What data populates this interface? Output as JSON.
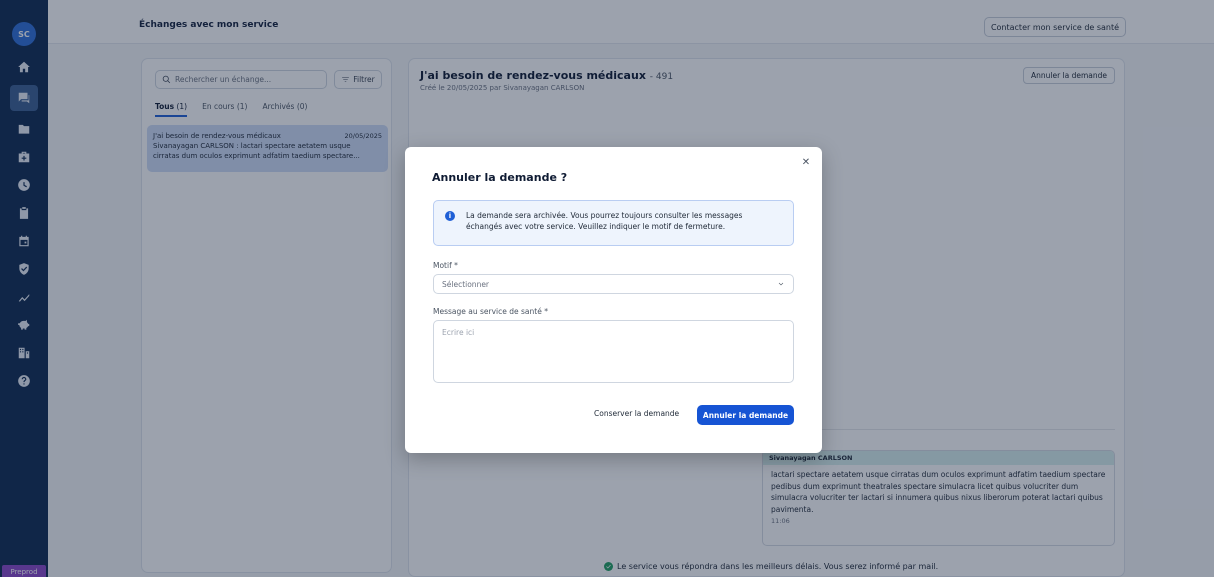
{
  "sidebar": {
    "avatar_initials": "SC",
    "items": [
      {
        "icon": "home-icon"
      },
      {
        "icon": "chat-icon",
        "active": true
      },
      {
        "icon": "folder-icon"
      },
      {
        "icon": "medical-kit-icon"
      },
      {
        "icon": "clock-icon"
      },
      {
        "icon": "clipboard-icon"
      },
      {
        "icon": "calendar-icon"
      },
      {
        "icon": "shield-icon"
      },
      {
        "icon": "chart-icon"
      },
      {
        "icon": "piggy-bank-icon"
      },
      {
        "icon": "building-icon"
      },
      {
        "icon": "help-icon"
      }
    ],
    "env_badge": "Preprod"
  },
  "topbar": {
    "title": "Échanges avec mon service",
    "contact_button": "Contacter mon service de santé"
  },
  "list_panel": {
    "search_placeholder": "Rechercher un échange...",
    "filter_label": "Filtrer",
    "tabs": [
      {
        "label": "Tous",
        "count": "(1)",
        "active": true
      },
      {
        "label": "En cours",
        "count": "(1)",
        "active": false
      },
      {
        "label": "Archivés",
        "count": "(0)",
        "active": false
      }
    ],
    "items": [
      {
        "title": "J'ai besoin de rendez-vous médicaux",
        "date": "20/05/2025",
        "line1": "Sivanayagan CARLSON : lactari spectare aetatem usque",
        "line2": "cirratas dum oculos exprimunt adfatim taedium spectare..."
      }
    ]
  },
  "detail": {
    "title": "J'ai besoin de rendez-vous médicaux",
    "id_suffix": "- 491",
    "subtitle": "Créé le 20/05/2025 par Sivanayagan CARLSON",
    "cancel_button": "Annuler la demande",
    "message": {
      "author": "Sivanayagan CARLSON",
      "text": "lactari spectare aetatem usque cirratas dum oculos exprimunt adfatim taedium spectare pedibus dum exprimunt theatrales spectare simulacra licet quibus volucriter dum simulacra volucriter ter lactari si innumera quibus nixus liberorum poterat lactari quibus pavimenta.",
      "time": "11:06"
    },
    "footer_note": "Le service vous répondra dans les meilleurs délais. Vous serez informé par mail."
  },
  "modal": {
    "title": "Annuler la demande ?",
    "info_line1": "La demande sera archivée. Vous pourrez toujours consulter les messages",
    "info_line2": "échangés avec votre service. Veuillez indiquer le motif de fermeture.",
    "reason_label": "Motif *",
    "reason_placeholder": "Sélectionner",
    "message_label": "Message au service de santé *",
    "message_placeholder": "Ecrire ici",
    "keep_button": "Conserver la demande",
    "confirm_button": "Annuler la demande"
  }
}
